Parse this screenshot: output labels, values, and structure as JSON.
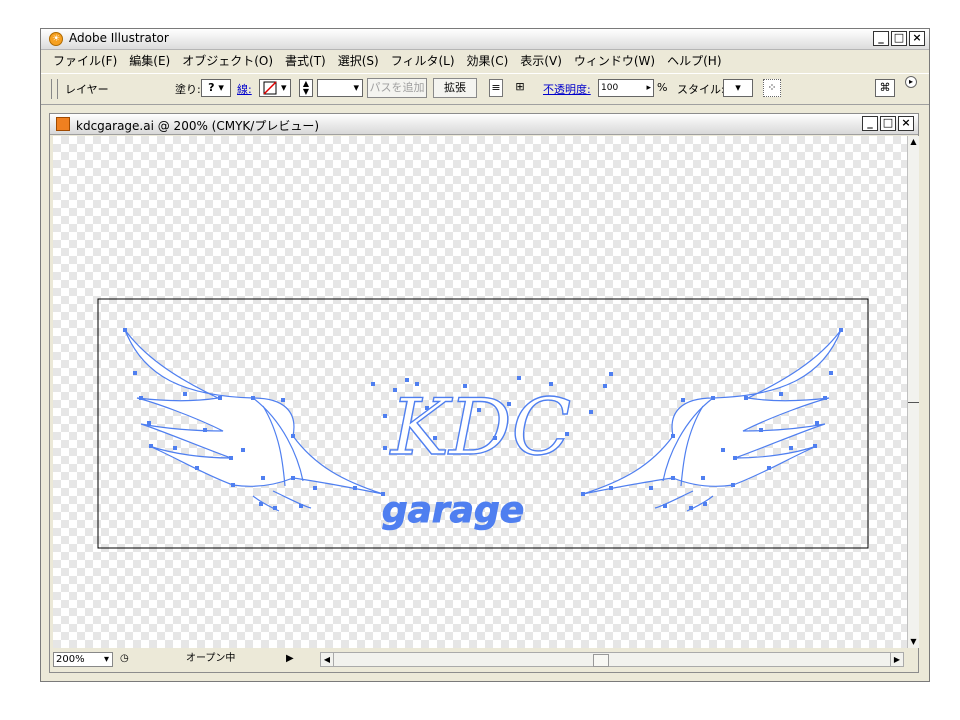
{
  "app": {
    "title": "Adobe Illustrator"
  },
  "window_controls": {
    "minimize": "_",
    "maximize": "□",
    "close": "×"
  },
  "menu": [
    "ファイル(F)",
    "編集(E)",
    "オブジェクト(O)",
    "書式(T)",
    "選択(S)",
    "フィルタ(L)",
    "効果(C)",
    "表示(V)",
    "ウィンドウ(W)",
    "ヘルプ(H)"
  ],
  "toolbar": {
    "layer_label": "レイヤー",
    "fill_label": "塗り:",
    "fill_value": "?",
    "stroke_label": "線:",
    "add_path_button": "パスを追加",
    "expand_button": "拡張",
    "opacity_label": "不透明度:",
    "opacity_value": "100",
    "percent": "%",
    "style_label": "スタイル:"
  },
  "document": {
    "title": "kdcgarage.ai @ 200% (CMYK/プレビュー)",
    "artwork_text_main": "KDC",
    "artwork_text_sub": "garage"
  },
  "status": {
    "zoom": "200%",
    "state": "オープン中"
  },
  "colors": {
    "path_blue": "#4f7ff0",
    "artboard_border": "#000000"
  }
}
